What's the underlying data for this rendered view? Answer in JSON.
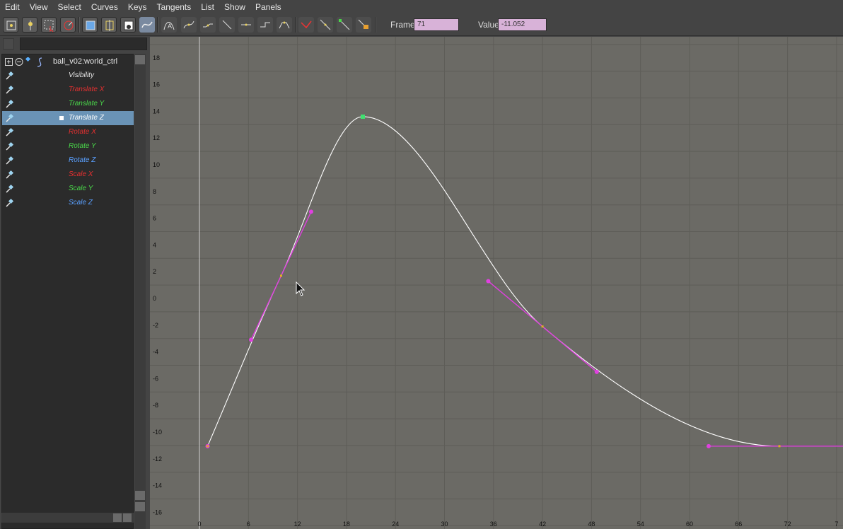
{
  "menu": [
    "Edit",
    "View",
    "Select",
    "Curves",
    "Keys",
    "Tangents",
    "List",
    "Show",
    "Panels"
  ],
  "toolbar": {
    "frame_label": "Frame",
    "frame_value": "71",
    "value_label": "Value",
    "value_value": "-11.052",
    "field_color": "#d8b2d8",
    "icons": [
      "move-keys-tool-icon",
      "insert-keys-tool-icon",
      "select-region-icon",
      "lattice-deform-icon",
      "frame-all-icon",
      "frame-playback-icon",
      "center-current-time-icon",
      "curve-display-icon",
      "auto-tangent-icon",
      "spline-tangent-icon",
      "clamped-tangent-icon",
      "linear-tangent-icon",
      "flat-tangent-icon",
      "step-tangent-icon",
      "plateau-tangent-icon",
      "break-tangents-icon",
      "unify-tangents-icon",
      "free-tangent-weight-icon",
      "lock-tangent-weight-icon"
    ]
  },
  "outliner": {
    "node": "ball_v02:world_ctrl",
    "selected_index": 3,
    "channels": [
      {
        "label": "Visibility",
        "color": "#e6e6e6"
      },
      {
        "label": "Translate X",
        "color": "#e53030"
      },
      {
        "label": "Translate Y",
        "color": "#4ad84a"
      },
      {
        "label": "Translate Z",
        "color": "#ffffff"
      },
      {
        "label": "Rotate X",
        "color": "#e53030"
      },
      {
        "label": "Rotate Y",
        "color": "#4ad84a"
      },
      {
        "label": "Rotate Z",
        "color": "#5aa0ff"
      },
      {
        "label": "Scale X",
        "color": "#e53030"
      },
      {
        "label": "Scale Y",
        "color": "#4ad84a"
      },
      {
        "label": "Scale Z",
        "color": "#5aa0ff"
      }
    ]
  },
  "chart_data": {
    "type": "line",
    "x_ticks": [
      "0",
      "6",
      "12",
      "18",
      "24",
      "30",
      "36",
      "42",
      "48",
      "54",
      "60",
      "66",
      "72",
      "7"
    ],
    "y_ticks": [
      "18",
      "16",
      "14",
      "12",
      "10",
      "8",
      "6",
      "4",
      "2",
      "0",
      "-2",
      "-4",
      "-6",
      "-8",
      "-10",
      "-12",
      "-14",
      "-16"
    ],
    "xlim": [
      0,
      78
    ],
    "ylim": [
      -17,
      19.3
    ],
    "grid": true,
    "curve_color": "#ffffff",
    "tangent_color": "#e040e0",
    "key_color": "#e0b020",
    "selected_key_color": "#40e070",
    "keys": [
      {
        "x": 1,
        "y": -11.05
      },
      {
        "x": 10,
        "y": 1.7
      },
      {
        "x": 20,
        "y": 13.6
      },
      {
        "x": 42,
        "y": -2.1
      },
      {
        "x": 71,
        "y": -11.05
      }
    ],
    "selected_key": 2
  }
}
